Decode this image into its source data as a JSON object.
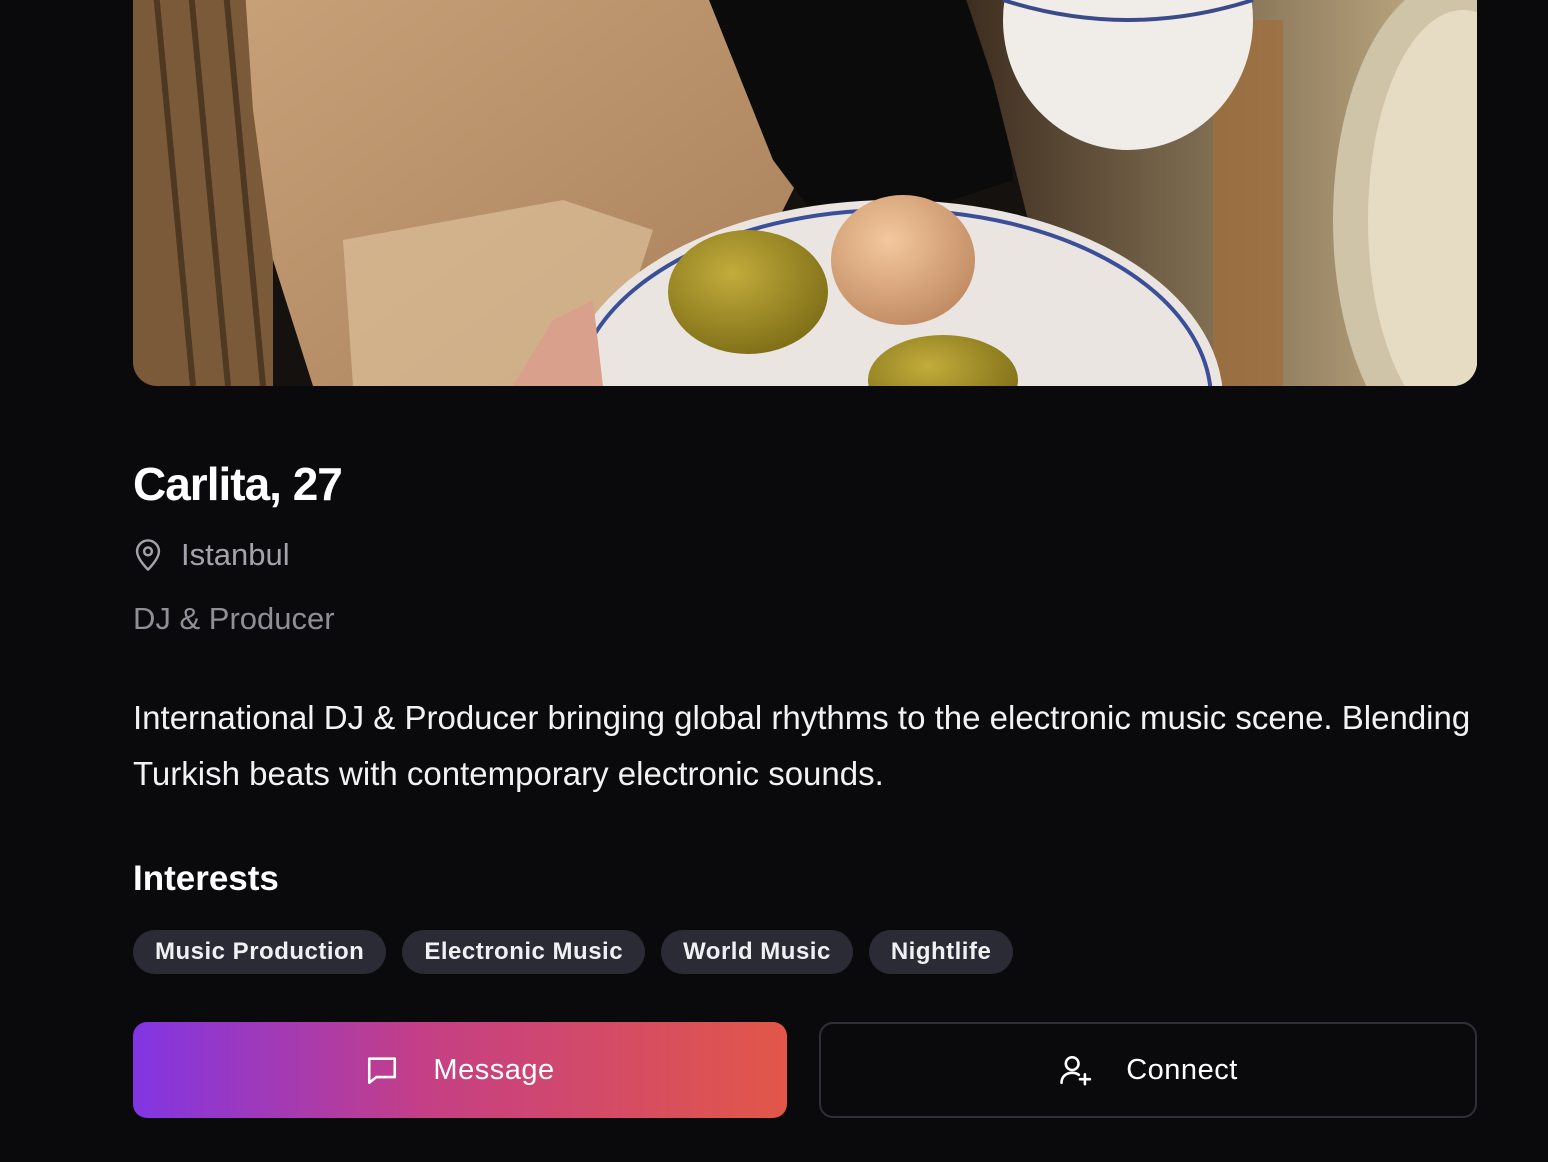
{
  "profile": {
    "photo_alt": "profile photo",
    "name_age": "Carlita, 27",
    "location": "Istanbul",
    "occupation": "DJ & Producer",
    "bio": "International DJ & Producer bringing global rhythms to the electronic music scene. Blending Turkish beats with contemporary electronic sounds."
  },
  "interests": {
    "title": "Interests",
    "items": [
      "Music Production",
      "Electronic Music",
      "World Music",
      "Nightlife"
    ]
  },
  "actions": {
    "message_label": "Message",
    "connect_label": "Connect"
  },
  "icons": {
    "location": "map-pin-icon",
    "message": "message-square-icon",
    "connect": "user-plus-icon"
  },
  "colors": {
    "background": "#0a0a0d",
    "chip_bg": "#2b2b36",
    "gradient_start": "#8135e3",
    "gradient_end": "#e25748",
    "muted_text": "#a3a3aa"
  }
}
